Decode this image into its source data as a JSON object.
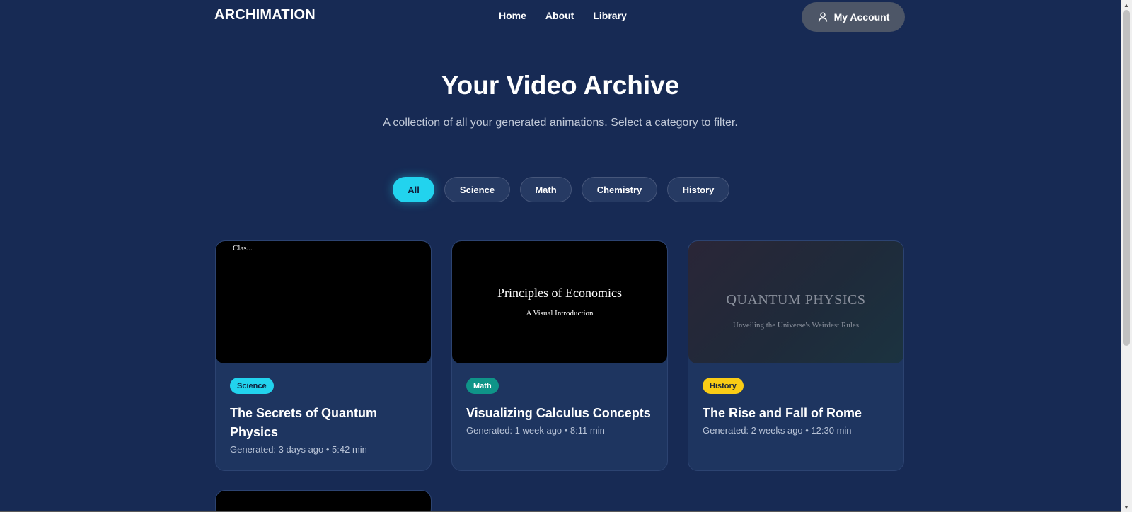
{
  "header": {
    "logo": "ARCHIMATION",
    "nav": [
      "Home",
      "About",
      "Library"
    ],
    "account_label": "My Account",
    "account_icon": "user-icon"
  },
  "hero": {
    "title": "Your Video Archive",
    "subtitle": "A collection of all your generated animations. Select a category to filter."
  },
  "filters": {
    "items": [
      "All",
      "Science",
      "Math",
      "Chemistry",
      "History"
    ],
    "selected": "All"
  },
  "cards": [
    {
      "thumb_text": "Clas...",
      "thumb_title": "",
      "thumb_subtitle": "",
      "tag": "Science",
      "tag_color": "#22d3ee",
      "title": "The Secrets of Quantum Physics",
      "meta": "Generated: 3 days ago • 5:42 min"
    },
    {
      "thumb_text": "",
      "thumb_title": "Principles of Economics",
      "thumb_subtitle": "A Visual Introduction",
      "tag": "Math",
      "tag_color": "#0f9488",
      "title": "Visualizing Calculus Concepts",
      "meta": "Generated: 1 week ago • 8:11 min"
    },
    {
      "thumb_text": "",
      "thumb_title": "QUANTUM PHYSICS",
      "thumb_subtitle": "Unveiling the Universe's Weirdest Rules",
      "tag": "History",
      "tag_color": "#facc15",
      "title": "The Rise and Fall of Rome",
      "meta": "Generated: 2 weeks ago • 12:30 min"
    }
  ],
  "colors": {
    "background": "#172a54",
    "card": "#1e3560",
    "accent": "#22d3ee"
  }
}
